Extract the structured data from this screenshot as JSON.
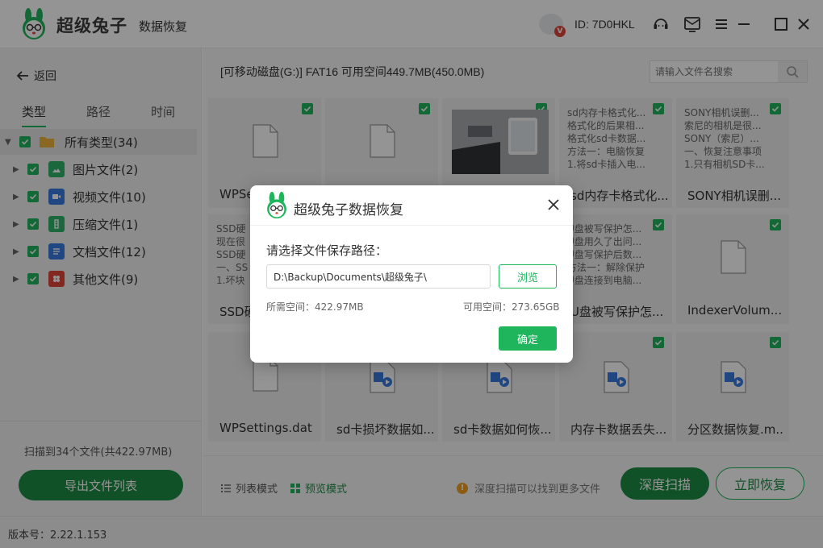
{
  "app": {
    "brand": "超级兔子",
    "brand_sub": "数据恢复",
    "user_id": "ID: 7D0HKL",
    "badge": "V",
    "accent": "#1fb55c",
    "accent_dark": "#1c8c45"
  },
  "sidebar": {
    "back_label": "返回",
    "tabs": [
      "类型",
      "路径",
      "时间"
    ],
    "tree": [
      {
        "label": "所有类型(34)",
        "icon": "folder-icon",
        "color": "#f0b43c"
      },
      {
        "label": "图片文件(2)",
        "icon": "image-file-icon",
        "color": "#2fb36a"
      },
      {
        "label": "视频文件(10)",
        "icon": "video-file-icon",
        "color": "#3a7be0"
      },
      {
        "label": "压缩文件(1)",
        "icon": "archive-file-icon",
        "color": "#2fb36a"
      },
      {
        "label": "文档文件(12)",
        "icon": "document-file-icon",
        "color": "#3a7be0"
      },
      {
        "label": "其他文件(9)",
        "icon": "other-file-icon",
        "color": "#e0463a"
      }
    ],
    "scan_summary": "扫描到34个文件(共422.97MB)",
    "export_label": "导出文件列表"
  },
  "main": {
    "drive_info": "[可移动磁盘(G:)] FAT16 可用空间449.7MB(450.0MB)",
    "search_placeholder": "请输入文件名搜索",
    "cards": [
      {
        "name": "WPSe",
        "kind": "doc"
      },
      {
        "name": "",
        "kind": "doc"
      },
      {
        "name": "",
        "kind": "photo"
      },
      {
        "name": "sd内存卡格式化...",
        "kind": "text",
        "preview": [
          "sd内存卡格式化...",
          "格式化的后果相...",
          "格式化sd卡数据...",
          "方法一：电脑恢复",
          "1.将sd卡插入电..."
        ]
      },
      {
        "name": "SONY相机误删...",
        "kind": "text",
        "preview": [
          "SONY相机误删...",
          "索尼的相机是很...",
          "SONY（索尼）...",
          "一、恢复注意事项",
          "1.只有相机SD卡..."
        ]
      },
      {
        "name": "SSD硬",
        "kind": "text",
        "preview": [
          "SSD硬",
          "现在很",
          "SSD硬",
          "一、SS",
          "1.坏块"
        ]
      },
      {
        "name": "",
        "kind": "hidden"
      },
      {
        "name": "",
        "kind": "hidden"
      },
      {
        "name": "U盘被写保护怎...",
        "kind": "text",
        "preview": [
          "U盘被写保护怎...",
          "U盘用久了出问...",
          "U盘写保护后数...",
          "方法一：解除保护",
          "U盘连接到电脑..."
        ]
      },
      {
        "name": "IndexerVolum...",
        "kind": "doc"
      },
      {
        "name": "WPSettings.dat",
        "kind": "doc"
      },
      {
        "name": "sd卡损坏数据如...",
        "kind": "media"
      },
      {
        "name": "sd卡数据如何恢...",
        "kind": "media"
      },
      {
        "name": "内存卡数据丢失...",
        "kind": "media"
      },
      {
        "name": "分区数据恢复.m...",
        "kind": "media"
      }
    ],
    "list_mode": "列表模式",
    "preview_mode": "预览模式",
    "hint": "深度扫描可以找到更多文件",
    "deep_scan": "深度扫描",
    "recover_now": "立即恢复"
  },
  "status": {
    "version": "版本号：2.22.1.153"
  },
  "dialog": {
    "title": "超级兔子数据恢复",
    "label": "请选择文件保存路径：",
    "path": "D:\\Backup\\Documents\\超级兔子\\",
    "browse": "浏览",
    "required_space": "所需空间：422.97MB",
    "available_space": "可用空间：273.65GB",
    "confirm": "确定"
  }
}
